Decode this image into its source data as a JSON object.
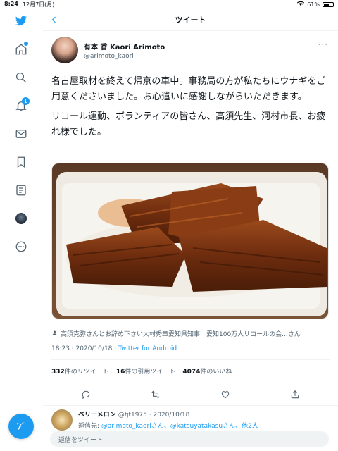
{
  "status_bar": {
    "time": "8:24",
    "date": "12月7日(月)",
    "battery": "61%",
    "battery_level": 0.61
  },
  "sidebar": {
    "icons": [
      "twitter-logo",
      "home-icon",
      "search-icon",
      "notifications-icon",
      "messages-icon",
      "bookmarks-icon",
      "lists-icon",
      "profile-avatar",
      "more-icon"
    ],
    "notification_count": "1"
  },
  "header": {
    "title": "ツイート"
  },
  "tweet": {
    "display_name": "有本 香 Kaori Arimoto",
    "handle": "@arimoto_kaori",
    "text_paragraphs": [
      "名古屋取材を終えて帰京の車中。事務局の方が私たちにウナギをご用意くださいました。お心遣いに感謝しながらいただきます。",
      "リコール運動、ボランティアの皆さん、高須先生、河村市長、お疲れ様でした。"
    ],
    "tagged": "高須克弥さんとお辞め下さい大村秀章愛知県知事　愛知100万人リコールの会...さん",
    "time": "18:23 · 2020/10/18 · ",
    "source": "Twitter for Android",
    "retweets_count": "332",
    "retweets_label": "件のリツイート",
    "quotes_count": "16",
    "quotes_label": "件の引用ツイート",
    "likes_count": "4074",
    "likes_label": "件のいいね"
  },
  "reply": {
    "display_name": "ベリーメロン",
    "meta": "@fjt1975 · 2020/10/18",
    "reply_prefix": "返信先: ",
    "reply_targets": "@arimoto_kaoriさん、@katsuyatakasuさん、他2人"
  },
  "reply_box": {
    "placeholder": "返信をツイート"
  },
  "colors": {
    "accent": "#1d9bf0",
    "text": "#0f1419",
    "muted": "#536471"
  }
}
